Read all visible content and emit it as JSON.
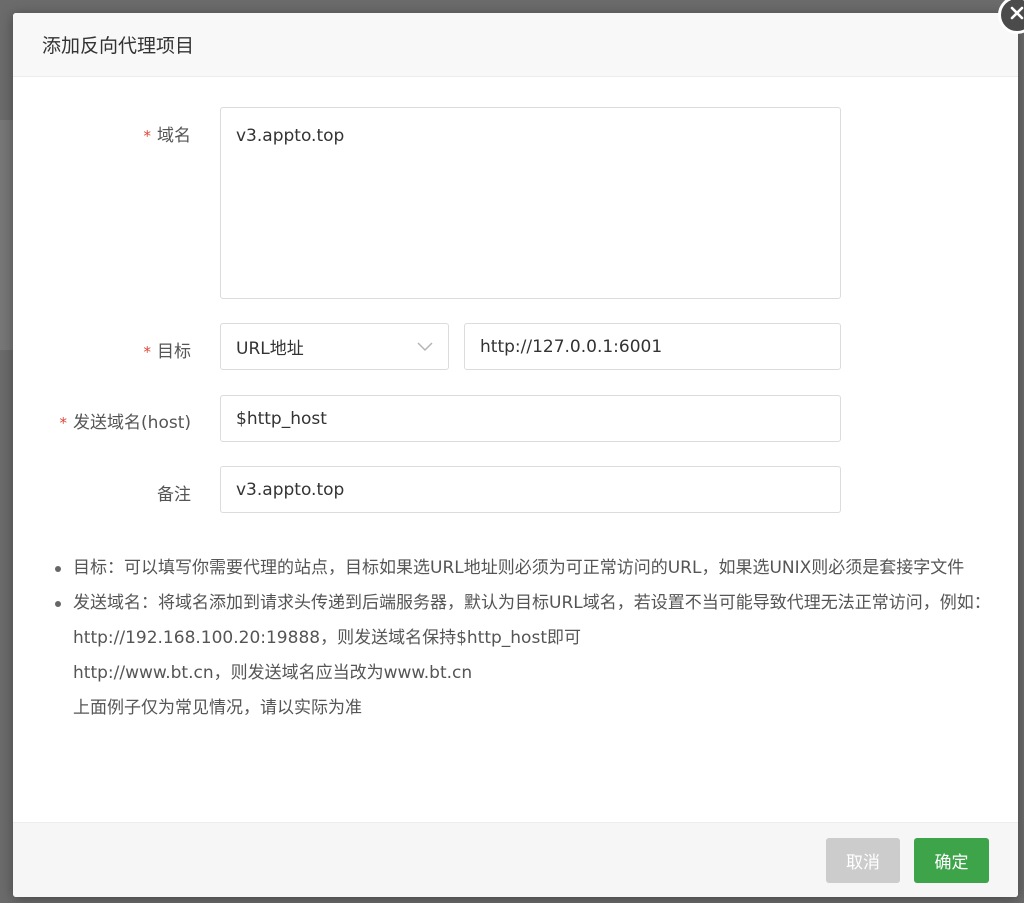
{
  "dialog": {
    "title": "添加反向代理项目",
    "close_icon": "close-icon"
  },
  "form": {
    "domain": {
      "required_mark": "*",
      "label": "域名",
      "value": "v3.appto.top"
    },
    "target": {
      "required_mark": "*",
      "label": "目标",
      "type_selected": "URL地址",
      "url_value": "http://127.0.0.1:6001"
    },
    "send_host": {
      "required_mark": "*",
      "label": "发送域名(host)",
      "value": "$http_host"
    },
    "remark": {
      "label": "备注",
      "value": "v3.appto.top"
    }
  },
  "notes": {
    "item1": "目标：可以填写你需要代理的站点，目标如果选URL地址则必须为可正常访问的URL，如果选UNIX则必须是套接字文件",
    "item2": "发送域名：将域名添加到请求头传递到后端服务器，默认为目标URL域名，若设置不当可能导致代理无法正常访问，例如：",
    "example1": "http://192.168.100.20:19888，则发送域名保持$http_host即可",
    "example2": "http://www.bt.cn，则发送域名应当改为www.bt.cn",
    "example3": "上面例子仅为常见情况，请以实际为准"
  },
  "footer": {
    "cancel_label": "取消",
    "confirm_label": "确定"
  },
  "colors": {
    "primary": "#3ea44a",
    "required": "#e0463a",
    "disabled_button": "#cccccc"
  }
}
